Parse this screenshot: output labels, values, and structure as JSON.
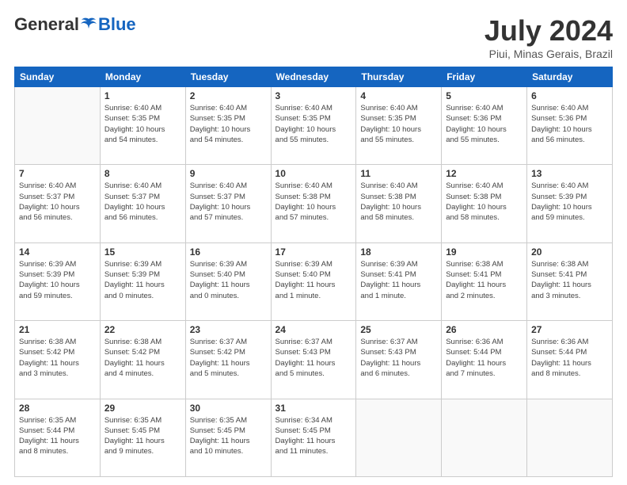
{
  "header": {
    "logo_general": "General",
    "logo_blue": "Blue",
    "title": "July 2024",
    "subtitle": "Piui, Minas Gerais, Brazil"
  },
  "days_of_week": [
    "Sunday",
    "Monday",
    "Tuesday",
    "Wednesday",
    "Thursday",
    "Friday",
    "Saturday"
  ],
  "weeks": [
    [
      {
        "day": "",
        "info": ""
      },
      {
        "day": "1",
        "info": "Sunrise: 6:40 AM\nSunset: 5:35 PM\nDaylight: 10 hours\nand 54 minutes."
      },
      {
        "day": "2",
        "info": "Sunrise: 6:40 AM\nSunset: 5:35 PM\nDaylight: 10 hours\nand 54 minutes."
      },
      {
        "day": "3",
        "info": "Sunrise: 6:40 AM\nSunset: 5:35 PM\nDaylight: 10 hours\nand 55 minutes."
      },
      {
        "day": "4",
        "info": "Sunrise: 6:40 AM\nSunset: 5:35 PM\nDaylight: 10 hours\nand 55 minutes."
      },
      {
        "day": "5",
        "info": "Sunrise: 6:40 AM\nSunset: 5:36 PM\nDaylight: 10 hours\nand 55 minutes."
      },
      {
        "day": "6",
        "info": "Sunrise: 6:40 AM\nSunset: 5:36 PM\nDaylight: 10 hours\nand 56 minutes."
      }
    ],
    [
      {
        "day": "7",
        "info": "Sunrise: 6:40 AM\nSunset: 5:37 PM\nDaylight: 10 hours\nand 56 minutes."
      },
      {
        "day": "8",
        "info": "Sunrise: 6:40 AM\nSunset: 5:37 PM\nDaylight: 10 hours\nand 56 minutes."
      },
      {
        "day": "9",
        "info": "Sunrise: 6:40 AM\nSunset: 5:37 PM\nDaylight: 10 hours\nand 57 minutes."
      },
      {
        "day": "10",
        "info": "Sunrise: 6:40 AM\nSunset: 5:38 PM\nDaylight: 10 hours\nand 57 minutes."
      },
      {
        "day": "11",
        "info": "Sunrise: 6:40 AM\nSunset: 5:38 PM\nDaylight: 10 hours\nand 58 minutes."
      },
      {
        "day": "12",
        "info": "Sunrise: 6:40 AM\nSunset: 5:38 PM\nDaylight: 10 hours\nand 58 minutes."
      },
      {
        "day": "13",
        "info": "Sunrise: 6:40 AM\nSunset: 5:39 PM\nDaylight: 10 hours\nand 59 minutes."
      }
    ],
    [
      {
        "day": "14",
        "info": "Sunrise: 6:39 AM\nSunset: 5:39 PM\nDaylight: 10 hours\nand 59 minutes."
      },
      {
        "day": "15",
        "info": "Sunrise: 6:39 AM\nSunset: 5:39 PM\nDaylight: 11 hours\nand 0 minutes."
      },
      {
        "day": "16",
        "info": "Sunrise: 6:39 AM\nSunset: 5:40 PM\nDaylight: 11 hours\nand 0 minutes."
      },
      {
        "day": "17",
        "info": "Sunrise: 6:39 AM\nSunset: 5:40 PM\nDaylight: 11 hours\nand 1 minute."
      },
      {
        "day": "18",
        "info": "Sunrise: 6:39 AM\nSunset: 5:41 PM\nDaylight: 11 hours\nand 1 minute."
      },
      {
        "day": "19",
        "info": "Sunrise: 6:38 AM\nSunset: 5:41 PM\nDaylight: 11 hours\nand 2 minutes."
      },
      {
        "day": "20",
        "info": "Sunrise: 6:38 AM\nSunset: 5:41 PM\nDaylight: 11 hours\nand 3 minutes."
      }
    ],
    [
      {
        "day": "21",
        "info": "Sunrise: 6:38 AM\nSunset: 5:42 PM\nDaylight: 11 hours\nand 3 minutes."
      },
      {
        "day": "22",
        "info": "Sunrise: 6:38 AM\nSunset: 5:42 PM\nDaylight: 11 hours\nand 4 minutes."
      },
      {
        "day": "23",
        "info": "Sunrise: 6:37 AM\nSunset: 5:42 PM\nDaylight: 11 hours\nand 5 minutes."
      },
      {
        "day": "24",
        "info": "Sunrise: 6:37 AM\nSunset: 5:43 PM\nDaylight: 11 hours\nand 5 minutes."
      },
      {
        "day": "25",
        "info": "Sunrise: 6:37 AM\nSunset: 5:43 PM\nDaylight: 11 hours\nand 6 minutes."
      },
      {
        "day": "26",
        "info": "Sunrise: 6:36 AM\nSunset: 5:44 PM\nDaylight: 11 hours\nand 7 minutes."
      },
      {
        "day": "27",
        "info": "Sunrise: 6:36 AM\nSunset: 5:44 PM\nDaylight: 11 hours\nand 8 minutes."
      }
    ],
    [
      {
        "day": "28",
        "info": "Sunrise: 6:35 AM\nSunset: 5:44 PM\nDaylight: 11 hours\nand 8 minutes."
      },
      {
        "day": "29",
        "info": "Sunrise: 6:35 AM\nSunset: 5:45 PM\nDaylight: 11 hours\nand 9 minutes."
      },
      {
        "day": "30",
        "info": "Sunrise: 6:35 AM\nSunset: 5:45 PM\nDaylight: 11 hours\nand 10 minutes."
      },
      {
        "day": "31",
        "info": "Sunrise: 6:34 AM\nSunset: 5:45 PM\nDaylight: 11 hours\nand 11 minutes."
      },
      {
        "day": "",
        "info": ""
      },
      {
        "day": "",
        "info": ""
      },
      {
        "day": "",
        "info": ""
      }
    ]
  ]
}
